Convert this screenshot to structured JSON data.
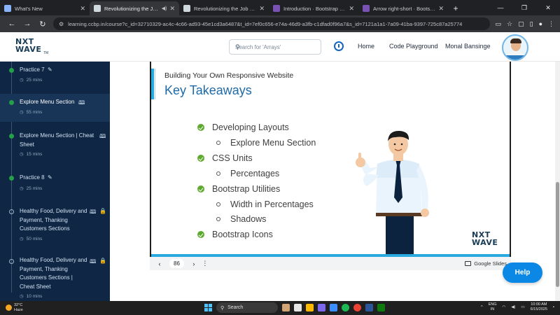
{
  "browser": {
    "tabs": [
      {
        "title": "What's New",
        "color": "#8ab4f8",
        "active": false
      },
      {
        "title": "Revolutionizing the Job Ma",
        "color": "#cfd8dc",
        "active": true
      },
      {
        "title": "Revolutionizing the Job Market",
        "color": "#cfd8dc",
        "active": false
      },
      {
        "title": "Introduction · Bootstrap v4.5",
        "color": "#7952b3",
        "active": false
      },
      {
        "title": "Arrow right-short · Bootstrap ic",
        "color": "#7952b3",
        "active": false
      }
    ],
    "url": "learning.ccbp.in/course?c_id=32710329-ac4c-4c66-ad93-45e1cd3a6487&t_id=7ef0c656-e74a-46d9-a3fb-c1dfad0f96a7&s_id=7121a1a1-7a09-41ba-9397-725c87a25774"
  },
  "header": {
    "logo_line1": "NXT",
    "logo_line2": "WAVE",
    "logo_tm": "TM",
    "search_placeholder": "Search for 'Arrays'",
    "nav": [
      "Home",
      "Code Playground",
      "Monal Bansinge"
    ]
  },
  "sidebar": {
    "items": [
      {
        "title": "Practice 7",
        "duration": "25 mins",
        "status": "done",
        "icon": "edit-icon"
      },
      {
        "title": "Explore Menu Section",
        "duration": "55 mins",
        "status": "done",
        "icon": "book-icon",
        "active": true
      },
      {
        "title": "Explore Menu Section | Cheat Sheet",
        "duration": "15 mins",
        "status": "done",
        "icon": "book-icon"
      },
      {
        "title": "Practice 8",
        "duration": "25 mins",
        "status": "done",
        "icon": "edit-icon"
      },
      {
        "title": "Healthy Food, Delivery and Payment, Thanking Customers Sections",
        "duration": "50 mins",
        "status": "locked",
        "icon": "book-icon"
      },
      {
        "title": "Healthy Food, Delivery and Payment, Thanking Customers Sections | Cheat Sheet",
        "duration": "10 mins",
        "status": "locked",
        "icon": "book-icon"
      }
    ]
  },
  "slide": {
    "kicker": "Building Your Own Responsive Website",
    "title": "Key Takeaways",
    "takeaways": [
      {
        "text": "Developing Layouts",
        "level": 0
      },
      {
        "text": "Explore Menu Section",
        "level": 1
      },
      {
        "text": "CSS Units",
        "level": 0
      },
      {
        "text": "Percentages",
        "level": 1
      },
      {
        "text": "Bootstrap Utilities",
        "level": 0
      },
      {
        "text": "Width in Percentages",
        "level": 1
      },
      {
        "text": "Shadows",
        "level": 1
      },
      {
        "text": "Bootstrap Icons",
        "level": 0
      }
    ],
    "logo_line1": "NXT",
    "logo_line2": "WAVE"
  },
  "slides_bar": {
    "page": "86",
    "brand": "Google Slides"
  },
  "help_label": "Help",
  "taskbar": {
    "temp": "32°C",
    "weather": "Haze",
    "search": "Search",
    "lang1": "ENG",
    "lang2": "IN",
    "time": "10:00 AM",
    "date": "6/15/2025"
  },
  "colors": {
    "sidebar_bg": "#0f2644",
    "accent_blue": "#1e6aa8",
    "check_green": "#5eaa2f",
    "help_blue": "#0b87e6"
  }
}
